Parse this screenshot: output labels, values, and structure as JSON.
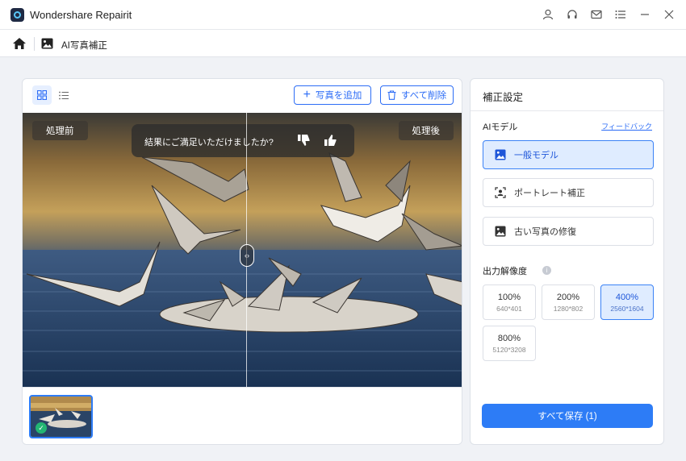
{
  "app": {
    "title": "Wondershare Repairit"
  },
  "window_icons": [
    "user-icon",
    "headset-icon",
    "mail-icon",
    "menu-icon",
    "minimize-icon",
    "close-icon"
  ],
  "breadcrumb": {
    "title": "AI写真補正"
  },
  "toolbar": {
    "add_label": "写真を追加",
    "delete_all_label": "すべて削除"
  },
  "preview": {
    "before_label": "処理前",
    "after_label": "処理後",
    "feedback_question": "結果にご満足いただけましたか?"
  },
  "settings": {
    "title": "補正設定",
    "model_label": "AIモデル",
    "feedback_link": "フィードバック",
    "models": [
      {
        "label": "一般モデル",
        "icon": "image-icon",
        "active": true
      },
      {
        "label": "ポートレート補正",
        "icon": "portrait-icon",
        "active": false
      },
      {
        "label": "古い写真の修復",
        "icon": "old-photo-icon",
        "active": false
      }
    ],
    "resolution_label": "出力解像度",
    "resolutions": [
      {
        "pct": "100%",
        "px": "640*401",
        "active": false
      },
      {
        "pct": "200%",
        "px": "1280*802",
        "active": false
      },
      {
        "pct": "400%",
        "px": "2560*1604",
        "active": true
      },
      {
        "pct": "800%",
        "px": "5120*3208",
        "active": false
      }
    ],
    "save_label": "すべて保存 (1)"
  },
  "colors": {
    "accent": "#2d7cf6",
    "active_bg": "#dfecff",
    "success": "#22b573"
  }
}
